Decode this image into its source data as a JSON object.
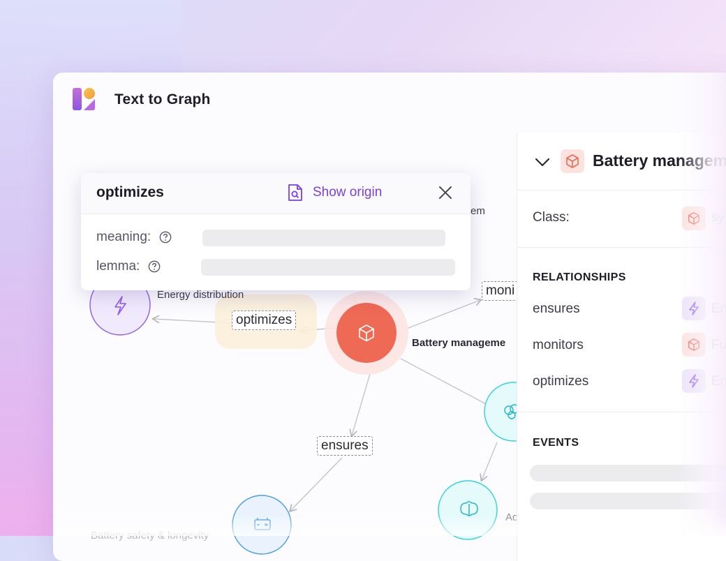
{
  "app": {
    "title": "Text to Graph"
  },
  "popup": {
    "title": "optimizes",
    "show_origin": "Show origin",
    "fields": [
      {
        "label": "meaning:"
      },
      {
        "label": "lemma:"
      }
    ]
  },
  "graph": {
    "edges": [
      "optimizes",
      "moni",
      "ensures"
    ],
    "nodes": {
      "energy": "Energy distribution",
      "battery": "Battery manageme",
      "system_partial": "em",
      "safety": "Battery safety & longevity",
      "ad_partial": "Ad"
    }
  },
  "panel": {
    "title": "Battery managem",
    "class_label": "Class:",
    "class_value": "sy",
    "relationships_heading": "RELATIONSHIPS",
    "relationships": [
      {
        "name": "ensures",
        "target": "En",
        "icon": "lightning-icon",
        "color": "#8b5cf6"
      },
      {
        "name": "monitors",
        "target": "Fu",
        "icon": "cube-icon",
        "color": "#ef6a55"
      },
      {
        "name": "optimizes",
        "target": "En",
        "icon": "lightning-icon",
        "color": "#8b5cf6"
      }
    ],
    "events_heading": "EVENTS"
  },
  "colors": {
    "accent": "#7b3fe4",
    "node_battery": "#ef6a55",
    "node_energy": "#8b5cf6",
    "node_teal": "#2fd4d8",
    "node_blue": "#4a9be8"
  }
}
